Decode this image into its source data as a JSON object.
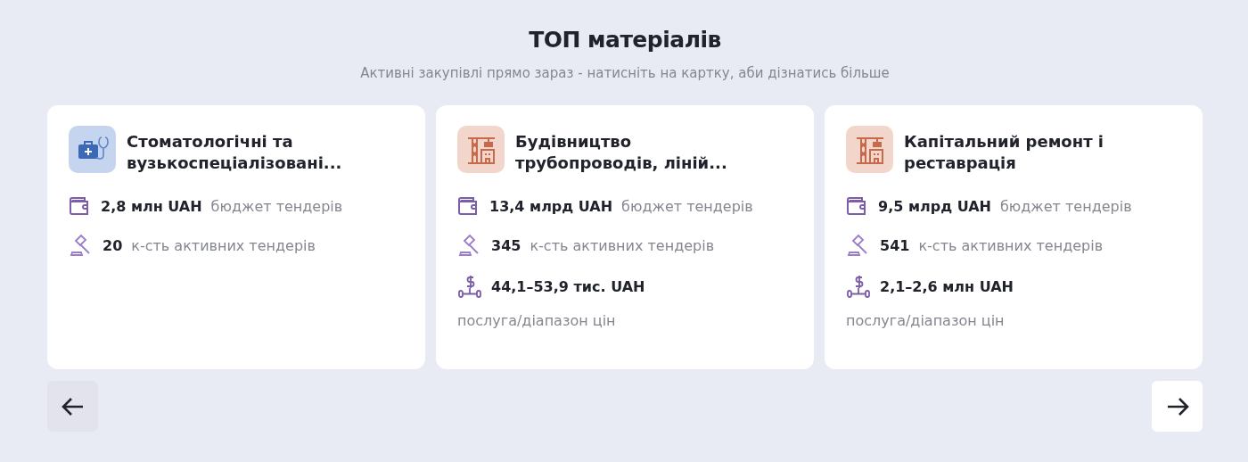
{
  "title": "ТОП матеріалів",
  "subtitle": "Активні закупівлі прямо зараз - натисніть на картку, аби дізнатись більше",
  "cards": [
    {
      "kind": "medical",
      "title": "Стоматологічні та вузькоспеціалізовані...",
      "stats": [
        {
          "kind": "budget",
          "value": "2,8 млн UAH",
          "caption": "бюджет тендерів"
        },
        {
          "kind": "count",
          "value": "20",
          "caption": "к-сть активних тендерів"
        }
      ]
    },
    {
      "kind": "construction",
      "title": "Будівництво трубопроводів, ліній...",
      "stats": [
        {
          "kind": "budget",
          "value": "13,4 млрд UAH",
          "caption": "бюджет тендерів"
        },
        {
          "kind": "count",
          "value": "345",
          "caption": "к-сть активних тендерів"
        },
        {
          "kind": "range",
          "value": "44,1–53,9 тис. UAH",
          "caption": "послуга/діапазон цін"
        }
      ]
    },
    {
      "kind": "construction",
      "title": "Капітальний ремонт і реставрація",
      "stats": [
        {
          "kind": "budget",
          "value": "9,5 млрд UAH",
          "caption": "бюджет тендерів"
        },
        {
          "kind": "count",
          "value": "541",
          "caption": "к-сть активних тендерів"
        },
        {
          "kind": "range",
          "value": "2,1–2,6 млн UAH",
          "caption": "послуга/діапазон цін"
        }
      ]
    }
  ],
  "nav": {
    "prev_disabled": true,
    "next_disabled": false
  }
}
